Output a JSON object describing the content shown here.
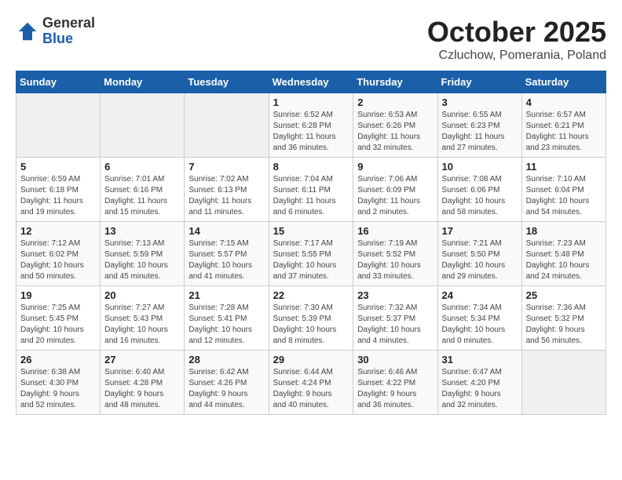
{
  "logo": {
    "general": "General",
    "blue": "Blue"
  },
  "header": {
    "month": "October 2025",
    "location": "Czluchow, Pomerania, Poland"
  },
  "weekdays": [
    "Sunday",
    "Monday",
    "Tuesday",
    "Wednesday",
    "Thursday",
    "Friday",
    "Saturday"
  ],
  "weeks": [
    [
      {
        "day": "",
        "info": ""
      },
      {
        "day": "",
        "info": ""
      },
      {
        "day": "",
        "info": ""
      },
      {
        "day": "1",
        "info": "Sunrise: 6:52 AM\nSunset: 6:28 PM\nDaylight: 11 hours\nand 36 minutes."
      },
      {
        "day": "2",
        "info": "Sunrise: 6:53 AM\nSunset: 6:26 PM\nDaylight: 11 hours\nand 32 minutes."
      },
      {
        "day": "3",
        "info": "Sunrise: 6:55 AM\nSunset: 6:23 PM\nDaylight: 11 hours\nand 27 minutes."
      },
      {
        "day": "4",
        "info": "Sunrise: 6:57 AM\nSunset: 6:21 PM\nDaylight: 11 hours\nand 23 minutes."
      }
    ],
    [
      {
        "day": "5",
        "info": "Sunrise: 6:59 AM\nSunset: 6:18 PM\nDaylight: 11 hours\nand 19 minutes."
      },
      {
        "day": "6",
        "info": "Sunrise: 7:01 AM\nSunset: 6:16 PM\nDaylight: 11 hours\nand 15 minutes."
      },
      {
        "day": "7",
        "info": "Sunrise: 7:02 AM\nSunset: 6:13 PM\nDaylight: 11 hours\nand 11 minutes."
      },
      {
        "day": "8",
        "info": "Sunrise: 7:04 AM\nSunset: 6:11 PM\nDaylight: 11 hours\nand 6 minutes."
      },
      {
        "day": "9",
        "info": "Sunrise: 7:06 AM\nSunset: 6:09 PM\nDaylight: 11 hours\nand 2 minutes."
      },
      {
        "day": "10",
        "info": "Sunrise: 7:08 AM\nSunset: 6:06 PM\nDaylight: 10 hours\nand 58 minutes."
      },
      {
        "day": "11",
        "info": "Sunrise: 7:10 AM\nSunset: 6:04 PM\nDaylight: 10 hours\nand 54 minutes."
      }
    ],
    [
      {
        "day": "12",
        "info": "Sunrise: 7:12 AM\nSunset: 6:02 PM\nDaylight: 10 hours\nand 50 minutes."
      },
      {
        "day": "13",
        "info": "Sunrise: 7:13 AM\nSunset: 5:59 PM\nDaylight: 10 hours\nand 45 minutes."
      },
      {
        "day": "14",
        "info": "Sunrise: 7:15 AM\nSunset: 5:57 PM\nDaylight: 10 hours\nand 41 minutes."
      },
      {
        "day": "15",
        "info": "Sunrise: 7:17 AM\nSunset: 5:55 PM\nDaylight: 10 hours\nand 37 minutes."
      },
      {
        "day": "16",
        "info": "Sunrise: 7:19 AM\nSunset: 5:52 PM\nDaylight: 10 hours\nand 33 minutes."
      },
      {
        "day": "17",
        "info": "Sunrise: 7:21 AM\nSunset: 5:50 PM\nDaylight: 10 hours\nand 29 minutes."
      },
      {
        "day": "18",
        "info": "Sunrise: 7:23 AM\nSunset: 5:48 PM\nDaylight: 10 hours\nand 24 minutes."
      }
    ],
    [
      {
        "day": "19",
        "info": "Sunrise: 7:25 AM\nSunset: 5:45 PM\nDaylight: 10 hours\nand 20 minutes."
      },
      {
        "day": "20",
        "info": "Sunrise: 7:27 AM\nSunset: 5:43 PM\nDaylight: 10 hours\nand 16 minutes."
      },
      {
        "day": "21",
        "info": "Sunrise: 7:28 AM\nSunset: 5:41 PM\nDaylight: 10 hours\nand 12 minutes."
      },
      {
        "day": "22",
        "info": "Sunrise: 7:30 AM\nSunset: 5:39 PM\nDaylight: 10 hours\nand 8 minutes."
      },
      {
        "day": "23",
        "info": "Sunrise: 7:32 AM\nSunset: 5:37 PM\nDaylight: 10 hours\nand 4 minutes."
      },
      {
        "day": "24",
        "info": "Sunrise: 7:34 AM\nSunset: 5:34 PM\nDaylight: 10 hours\nand 0 minutes."
      },
      {
        "day": "25",
        "info": "Sunrise: 7:36 AM\nSunset: 5:32 PM\nDaylight: 9 hours\nand 56 minutes."
      }
    ],
    [
      {
        "day": "26",
        "info": "Sunrise: 6:38 AM\nSunset: 4:30 PM\nDaylight: 9 hours\nand 52 minutes."
      },
      {
        "day": "27",
        "info": "Sunrise: 6:40 AM\nSunset: 4:28 PM\nDaylight: 9 hours\nand 48 minutes."
      },
      {
        "day": "28",
        "info": "Sunrise: 6:42 AM\nSunset: 4:26 PM\nDaylight: 9 hours\nand 44 minutes."
      },
      {
        "day": "29",
        "info": "Sunrise: 6:44 AM\nSunset: 4:24 PM\nDaylight: 9 hours\nand 40 minutes."
      },
      {
        "day": "30",
        "info": "Sunrise: 6:46 AM\nSunset: 4:22 PM\nDaylight: 9 hours\nand 36 minutes."
      },
      {
        "day": "31",
        "info": "Sunrise: 6:47 AM\nSunset: 4:20 PM\nDaylight: 9 hours\nand 32 minutes."
      },
      {
        "day": "",
        "info": ""
      }
    ]
  ]
}
